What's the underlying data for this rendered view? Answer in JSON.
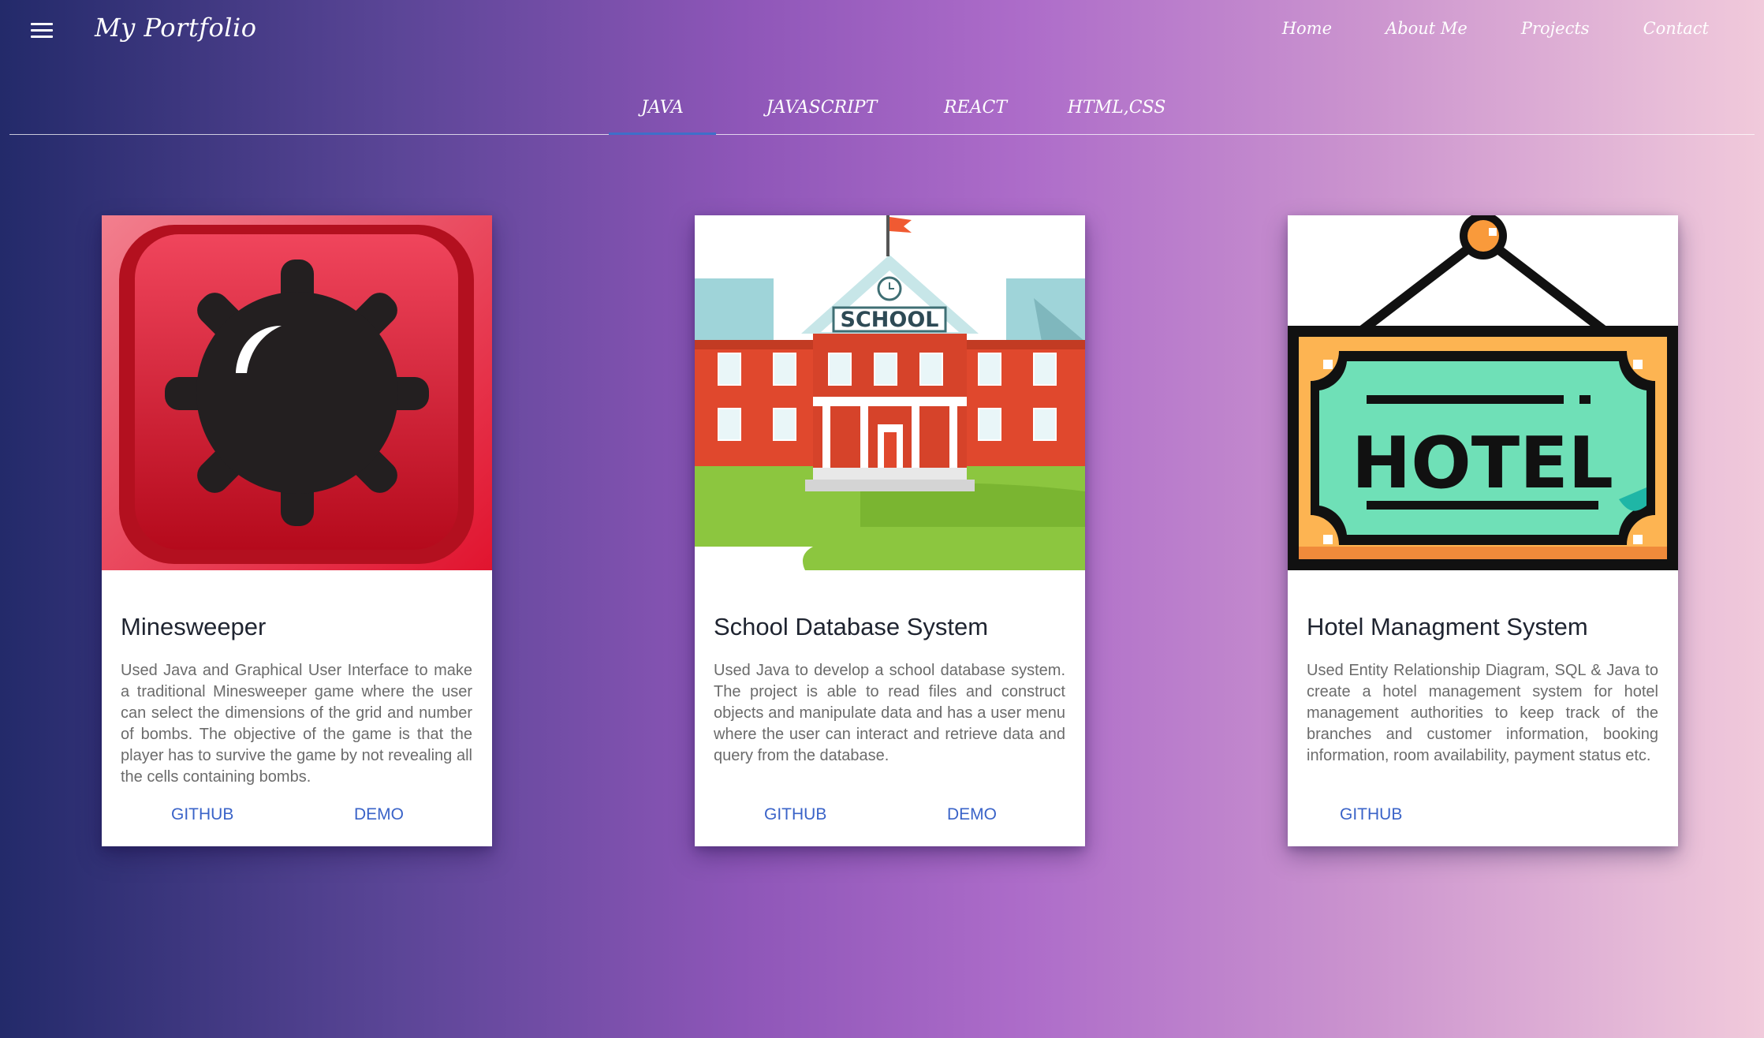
{
  "appbar": {
    "brand": "My Portfolio",
    "menu_icon": "hamburger-menu-icon",
    "nav": [
      {
        "label": "Home"
      },
      {
        "label": "About Me"
      },
      {
        "label": "Projects"
      },
      {
        "label": "Contact"
      }
    ]
  },
  "tabs": [
    {
      "label": "JAVA",
      "active": true
    },
    {
      "label": "JAVASCRIPT",
      "active": false
    },
    {
      "label": "REACT",
      "active": false
    },
    {
      "label": "HTML,CSS",
      "active": false
    }
  ],
  "cards": [
    {
      "image": "minesweeper-bomb-icon",
      "title": "Minesweeper",
      "description": "Used Java and Graphical User Interface to make a traditional Minesweeper game where the user can select the dimensions of the grid and number of bombs. The objective of the game is that the player has to survive the game by not revealing all the cells containing bombs.",
      "actions": [
        "GITHUB",
        "DEMO"
      ]
    },
    {
      "image": "school-building-illustration",
      "image_text": "SCHOOL",
      "title": "School Database System",
      "description": "Used Java to develop a school database system. The project is able to read files and construct objects and manipulate data and has a user menu where the user can interact and retrieve data and query from the database.",
      "actions": [
        "GITHUB",
        "DEMO"
      ]
    },
    {
      "image": "hotel-hanging-sign-icon",
      "image_text": "HOTEL",
      "title": "Hotel Managment System",
      "description": "Used Entity Relationship Diagram, SQL & Java to create a hotel management system for hotel management authorities to keep track of the branches and customer information, booking information, room availability, payment status etc.",
      "actions": [
        "GITHUB"
      ]
    }
  ],
  "colors": {
    "gradient_start": "#232a6a",
    "gradient_mid": "#ad6cc9",
    "gradient_end": "#f1cadb",
    "link": "#3a63c8",
    "active_tab_indicator": "#3f6fc9"
  }
}
